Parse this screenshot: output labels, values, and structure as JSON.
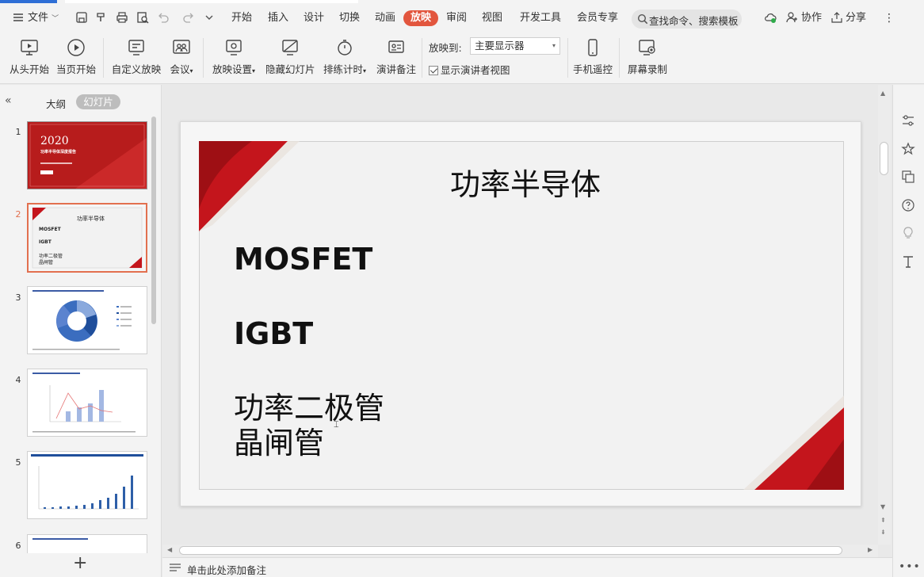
{
  "menu": {
    "file_label": "文件",
    "tabs": [
      "开始",
      "插入",
      "设计",
      "切换",
      "动画",
      "放映",
      "审阅",
      "视图",
      "开发工具",
      "会员专享"
    ],
    "active_tab": "放映",
    "search_placeholder": "查找命令、搜索模板",
    "collaborate_label": "协作",
    "share_label": "分享"
  },
  "ribbon": {
    "from_start": "从头开始",
    "from_current": "当页开始",
    "custom_show": "自定义放映",
    "meeting": "会议",
    "show_settings": "放映设置",
    "hide_slide": "隐藏幻灯片",
    "rehearse_timing": "排练计时",
    "speaker_notes": "演讲备注",
    "play_to_label": "放映到:",
    "play_to_value": "主要显示器",
    "presenter_view_label": "显示演讲者视图",
    "presenter_view_checked": true,
    "phone_remote": "手机遥控",
    "screen_record": "屏幕录制"
  },
  "left_panel": {
    "tab_outline": "大纲",
    "tab_slides": "幻灯片",
    "slides": [
      {
        "num": "1",
        "title": "2020",
        "subtitle": "功率半导体深度报告"
      },
      {
        "num": "2",
        "title": "功率半导体",
        "lines": [
          "MOSFET",
          "IGBT",
          "功率二极管",
          "晶闸管"
        ]
      },
      {
        "num": "3"
      },
      {
        "num": "4"
      },
      {
        "num": "5"
      },
      {
        "num": "6"
      }
    ],
    "add_slide": "+"
  },
  "slide": {
    "title": "功率半导体",
    "bullets": [
      "MOSFET",
      "IGBT",
      "功率二极管",
      "晶闸管"
    ],
    "accent_color": "#c4151c"
  },
  "notes": {
    "placeholder": "单击此处添加备注"
  }
}
